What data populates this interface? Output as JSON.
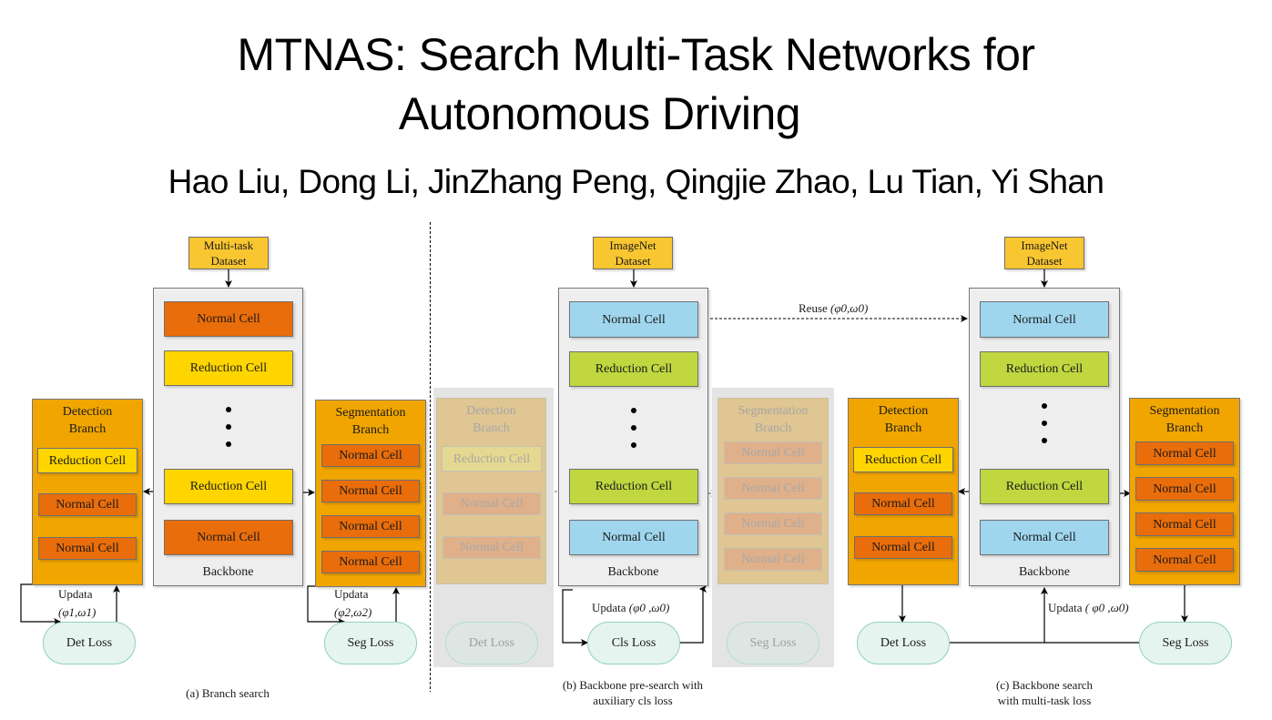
{
  "header": {
    "title_line1": "MTNAS: Search Multi-Task Networks for",
    "title_line2": "Autonomous Driving",
    "authors": "Hao Liu, Dong Li, JinZhang Peng, Qingjie Zhao, Lu Tian, Yi Shan"
  },
  "colors": {
    "normal_cell_orange": "#e96d0a",
    "reduction_cell_yellow": "#ffd500",
    "normal_cell_blue": "#9fd6ee",
    "reduction_cell_green": "#c0d740",
    "branch_orange": "#f0a500",
    "dataset_yellow": "#f8c630",
    "loss_mint": "#e6f4ef",
    "backbone_gray": "#eeeeee"
  },
  "panel_a": {
    "dataset": [
      "Multi-task",
      "Dataset"
    ],
    "backbone": {
      "label": "Backbone",
      "cells": [
        "Normal Cell",
        "Reduction Cell",
        "Reduction Cell",
        "Normal Cell"
      ]
    },
    "detection_branch": {
      "title": [
        "Detection",
        "Branch"
      ],
      "cells": [
        "Reduction Cell",
        "Normal Cell",
        "Normal Cell"
      ]
    },
    "segmentation_branch": {
      "title": [
        "Segmentation",
        "Branch"
      ],
      "cells": [
        "Normal Cell",
        "Normal Cell",
        "Normal Cell",
        "Normal Cell"
      ]
    },
    "det_update": {
      "label": "Updata",
      "params": "(φ1,ω1)"
    },
    "seg_update": {
      "label": "Updata",
      "params": "(φ2,ω2)"
    },
    "det_loss": "Det Loss",
    "seg_loss": "Seg Loss",
    "caption": "(a) Branch search"
  },
  "panel_b": {
    "dataset": [
      "ImageNet",
      "Dataset"
    ],
    "backbone": {
      "label": "Backbone",
      "cells": [
        "Normal Cell",
        "Reduction Cell",
        "Reduction Cell",
        "Normal Cell"
      ]
    },
    "detection_branch": {
      "title": [
        "Detection",
        "Branch"
      ],
      "cells": [
        "Reduction Cell",
        "Normal Cell",
        "Normal Cell"
      ]
    },
    "segmentation_branch": {
      "title": [
        "Segmentation",
        "Branch"
      ],
      "cells": [
        "Normal Cell",
        "Normal Cell",
        "Normal Cell",
        "Normal Cell"
      ]
    },
    "update": {
      "label": "Updata",
      "params": "(φ0 ,ω0)"
    },
    "det_loss": "Det Loss",
    "cls_loss": "Cls Loss",
    "seg_loss": "Seg Loss",
    "caption_line1": "(b) Backbone pre-search with",
    "caption_line2": "auxiliary cls loss"
  },
  "reuse": {
    "label": "Reuse",
    "params": "(φ0,ω0)"
  },
  "panel_c": {
    "dataset": [
      "ImageNet",
      "Dataset"
    ],
    "backbone": {
      "label": "Backbone",
      "cells": [
        "Normal Cell",
        "Reduction Cell",
        "Reduction Cell",
        "Normal Cell"
      ]
    },
    "detection_branch": {
      "title": [
        "Detection",
        "Branch"
      ],
      "cells": [
        "Reduction Cell",
        "Normal Cell",
        "Normal Cell"
      ]
    },
    "segmentation_branch": {
      "title": [
        "Segmentation",
        "Branch"
      ],
      "cells": [
        "Normal Cell",
        "Normal Cell",
        "Normal Cell",
        "Normal Cell"
      ]
    },
    "update": {
      "label": "Updata",
      "params": "( φ0 ,ω0)"
    },
    "det_loss": "Det Loss",
    "seg_loss": "Seg Loss",
    "caption_line1": "(c) Backbone search",
    "caption_line2": "with multi-task loss"
  }
}
